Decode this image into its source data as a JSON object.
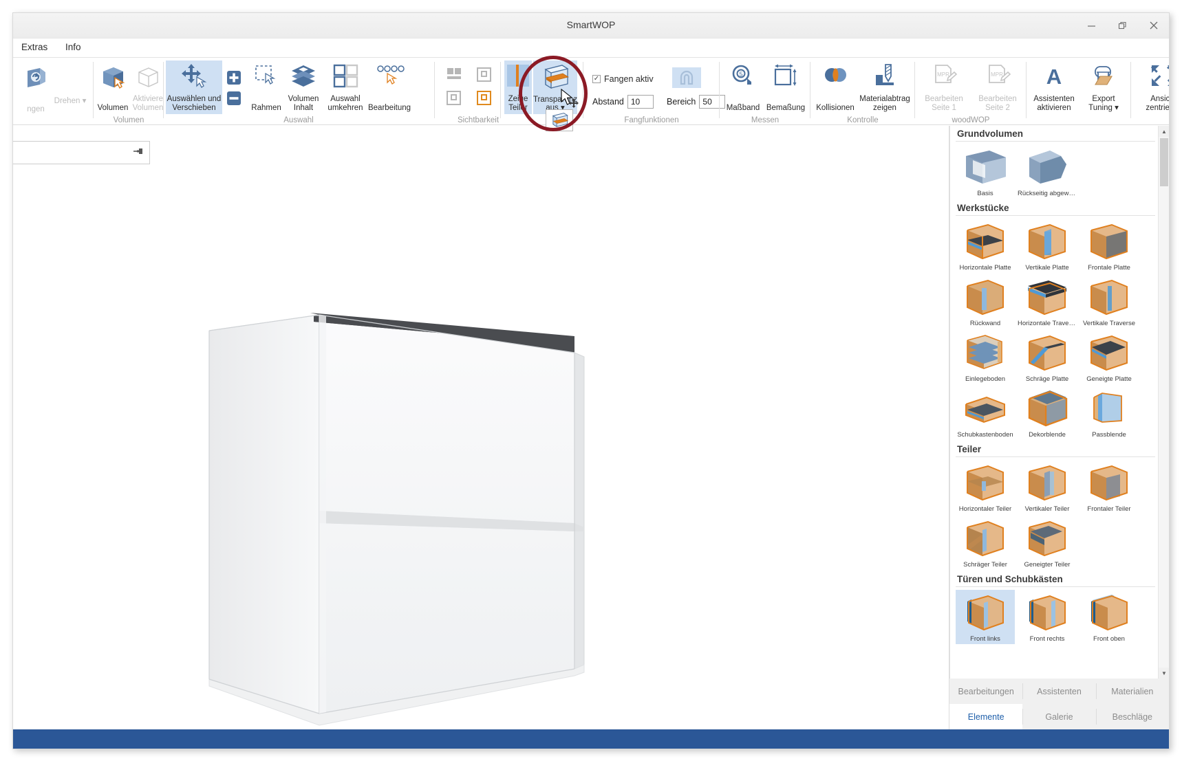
{
  "window": {
    "title": "SmartWOP",
    "minimize": "–",
    "maximize": "❐",
    "close": "✕"
  },
  "menu": [
    {
      "label": "Extras"
    },
    {
      "label": "Info"
    }
  ],
  "ribbon": {
    "groups": [
      {
        "name": "volumen",
        "label": "Volumen",
        "buttons": [
          {
            "label": "Volumen",
            "icon": "solid-cube-icon",
            "state": "normal"
          },
          {
            "label": "Aktiviere Volumen",
            "icon": "wire-cube-icon",
            "state": "disabled"
          }
        ]
      },
      {
        "name": "auswahl",
        "label": "Auswahl",
        "buttons": [
          {
            "label": "Auswählen und Verschieben",
            "icon": "move-arrows-icon",
            "state": "active"
          },
          {
            "label": "Rahmen",
            "icon": "marquee-select-icon",
            "state": "normal"
          },
          {
            "label": "Volumen Inhalt",
            "icon": "layers-icon",
            "state": "normal"
          },
          {
            "label": "Auswahl umkehren",
            "icon": "invert-selection-icon",
            "state": "normal"
          },
          {
            "label": "Bearbeitung",
            "icon": "holes-row-icon",
            "state": "normal"
          }
        ],
        "plus": "+",
        "minus": "–"
      },
      {
        "name": "sichtbarkeit",
        "label": "Sichtbarkeit",
        "buttons": [
          {
            "label": "Zeige Teiler",
            "icon": "show-divider-icon",
            "state": "active"
          },
          {
            "label": "Transparenz aus",
            "icon": "transparency-off-icon",
            "state": "active",
            "has_dropdown": true
          }
        ],
        "toggles": [
          {
            "name": "split-view-icon",
            "color": "#b6b6b6"
          },
          {
            "name": "frame-view-icon",
            "color": "#b6b6b6"
          },
          {
            "name": "single-view-icon",
            "color": "#b6b6b6"
          },
          {
            "name": "highlight-view-icon",
            "color": "#e08a1e"
          }
        ]
      },
      {
        "name": "fangfunktionen",
        "label": "Fangfunktionen",
        "checkbox": {
          "label": "Fangen aktiv",
          "checked": true,
          "mark": "✓"
        },
        "fields": [
          {
            "label": "Abstand",
            "value": "10"
          },
          {
            "label": "Bereich",
            "value": "50"
          }
        ],
        "magnet_icon": "magnet-snap-icon"
      },
      {
        "name": "messen",
        "label": "Messen",
        "buttons": [
          {
            "label": "Maßband",
            "icon": "tape-measure-icon",
            "state": "normal"
          },
          {
            "label": "Bemaßung",
            "icon": "dimension-icon",
            "state": "normal"
          }
        ]
      },
      {
        "name": "kontrolle",
        "label": "Kontrolle",
        "buttons": [
          {
            "label": "Kollisionen",
            "icon": "collision-circles-icon",
            "state": "normal"
          },
          {
            "label": "Materialabtrag zeigen",
            "icon": "milling-tool-icon",
            "state": "normal"
          }
        ]
      },
      {
        "name": "woodwop",
        "label": "woodWOP",
        "buttons": [
          {
            "label": "Bearbeiten Seite 1",
            "icon": "mpr-edit-icon",
            "state": "disabled"
          },
          {
            "label": "Bearbeiten Seite 2",
            "icon": "mpr-edit-icon",
            "state": "disabled"
          }
        ]
      },
      {
        "name": "assistenten",
        "label": "",
        "buttons": [
          {
            "label": "Assistenten aktivieren",
            "icon": "letter-a-icon",
            "state": "normal"
          },
          {
            "label": "Export Tuning",
            "icon": "export-tuning-icon",
            "state": "normal",
            "has_dropdown": true
          }
        ]
      },
      {
        "name": "ansicht",
        "label": "",
        "buttons": [
          {
            "label": "Ansicht zentrieren",
            "icon": "center-view-icon",
            "state": "normal"
          }
        ]
      }
    ]
  },
  "viewport": {
    "dock_pin_icon": "pin-icon",
    "model": "white-cabinet-3d"
  },
  "library": {
    "scrollbar": {
      "up": "▲",
      "down": "▼"
    },
    "categories": [
      {
        "title": "Grundvolumen",
        "items": [
          {
            "label": "Basis",
            "icon": "basis-box-icon",
            "selected": false
          },
          {
            "label": "Rückseitig abgewink...",
            "icon": "angled-back-box-icon",
            "selected": false
          }
        ]
      },
      {
        "title": "Werkstücke",
        "items": [
          {
            "label": "Horizontale Platte",
            "icon": "horizontal-panel-icon",
            "selected": false
          },
          {
            "label": "Vertikale Platte",
            "icon": "vertical-panel-icon",
            "selected": false
          },
          {
            "label": "Frontale Platte",
            "icon": "frontal-panel-icon",
            "selected": false
          },
          {
            "label": "Rückwand",
            "icon": "back-wall-icon",
            "selected": false
          },
          {
            "label": "Horizontale Traverse",
            "icon": "horizontal-rail-icon",
            "selected": false
          },
          {
            "label": "Vertikale Traverse",
            "icon": "vertical-rail-icon",
            "selected": false
          },
          {
            "label": "Einlegeboden",
            "icon": "shelf-icon",
            "selected": false
          },
          {
            "label": "Schräge Platte",
            "icon": "slanted-panel-icon",
            "selected": false
          },
          {
            "label": "Geneigte Platte",
            "icon": "inclined-panel-icon",
            "selected": false
          },
          {
            "label": "Schubkastenboden",
            "icon": "drawer-bottom-icon",
            "selected": false
          },
          {
            "label": "Dekorblende",
            "icon": "decor-panel-icon",
            "selected": false
          },
          {
            "label": "Passblende",
            "icon": "filler-panel-icon",
            "selected": false
          }
        ]
      },
      {
        "title": "Teiler",
        "items": [
          {
            "label": "Horizontaler Teiler",
            "icon": "horizontal-divider-icon",
            "selected": false
          },
          {
            "label": "Vertikaler Teiler",
            "icon": "vertical-divider-icon",
            "selected": false
          },
          {
            "label": "Frontaler Teiler",
            "icon": "frontal-divider-icon",
            "selected": false
          },
          {
            "label": "Schräger Teiler",
            "icon": "slanted-divider-icon",
            "selected": false
          },
          {
            "label": "Geneigter Teiler",
            "icon": "inclined-divider-icon",
            "selected": false
          }
        ]
      },
      {
        "title": "Türen und Schubkästen",
        "items": [
          {
            "label": "Front links",
            "icon": "door-left-icon",
            "selected": true
          },
          {
            "label": "Front rechts",
            "icon": "door-right-icon",
            "selected": false
          },
          {
            "label": "Front oben",
            "icon": "door-top-icon",
            "selected": false
          }
        ]
      }
    ]
  },
  "panel_tabs": {
    "row1": [
      {
        "label": "Bearbeitungen",
        "active": false
      },
      {
        "label": "Assistenten",
        "active": false
      },
      {
        "label": "Materialien",
        "active": false
      }
    ],
    "row2": [
      {
        "label": "Elemente",
        "active": true
      },
      {
        "label": "Galerie",
        "active": false
      },
      {
        "label": "Beschläge",
        "active": false
      }
    ]
  },
  "annotation": {
    "shape": "ellipse",
    "color": "#8b1a25",
    "target": "Transparenz aus"
  },
  "colors": {
    "accent": "#2b5797",
    "ribbon_active": "#cfe0f3",
    "orange": "#e08a1e",
    "annotation_red": "#8b1a25"
  }
}
